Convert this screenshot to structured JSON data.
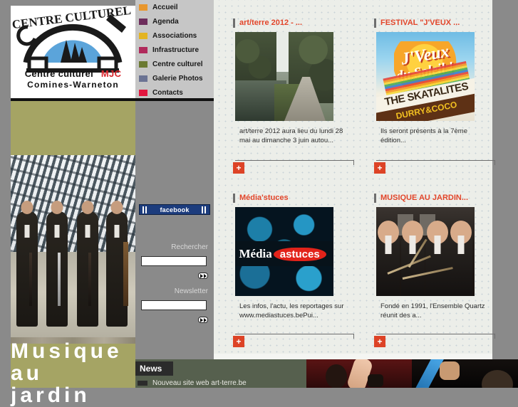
{
  "site": {
    "logo": {
      "arc_text": "CENTRE CULTUREL",
      "line1": "Centre culturel",
      "line1_accent": "MJC",
      "line2": "Comines-Warneton"
    }
  },
  "nav": {
    "items": [
      {
        "label": "Accueil",
        "color": "#e8972e",
        "name": "nav-item-accueil"
      },
      {
        "label": "Agenda",
        "color": "#6d2d5c",
        "name": "nav-item-agenda"
      },
      {
        "label": "Associations",
        "color": "#e3b423",
        "name": "nav-item-associations"
      },
      {
        "label": "Infrastructure",
        "color": "#b02a5b",
        "name": "nav-item-infrastructure"
      },
      {
        "label": "Centre culturel",
        "color": "#6b7a32",
        "name": "nav-item-centre-culturel"
      },
      {
        "label": "Galerie Photos",
        "color": "#6b7393",
        "name": "nav-item-galerie-photos"
      },
      {
        "label": "Contacts",
        "color": "#e2163f",
        "name": "nav-item-contacts"
      }
    ]
  },
  "sidebar": {
    "facebook_label": "facebook",
    "search": {
      "label": "Rechercher",
      "value": "",
      "placeholder": "",
      "go_label": "▶▶"
    },
    "newsletter": {
      "label": "Newsletter",
      "value": "",
      "placeholder": "",
      "go_label": "▶▶"
    }
  },
  "left_feature": {
    "title_line1": "Musique",
    "title_line2": "au",
    "title_line3": "jardin"
  },
  "cards": [
    {
      "title": "art/terre 2012 - ...",
      "desc": "art/terre 2012 aura lieu du lundi 28 mai au dimanche 3 juin autou...",
      "plus_label": "+",
      "thumb": "canal-path-photo"
    },
    {
      "title": "FESTIVAL \"J'VEUX ...",
      "desc": "Ils seront présents à la 7ème édition...",
      "plus_label": "+",
      "thumb": "jveux-du-soleil-poster",
      "poster": {
        "line1": "J'Veux",
        "line2": "du Soleil !",
        "band1": "THE SKATALITES",
        "band2": "DURRY&COCO"
      }
    },
    {
      "title": "Média'stuces",
      "desc": "Les infos, l'actu, les reportages sur www.mediastuces.bePui...",
      "plus_label": "+",
      "thumb": "mediastuces-logo",
      "logo": {
        "part1": "Média",
        "part2": "astuces"
      }
    },
    {
      "title": "MUSIQUE AU JARDIN...",
      "desc": "Fondé en 1991, l'Ensemble Quartz réunit des a...",
      "plus_label": "+",
      "thumb": "ensemble-quartz-photo"
    }
  ],
  "news": {
    "tab_label": "News",
    "items": [
      {
        "label": "Nouveau site web art-terre.be"
      }
    ]
  },
  "colors": {
    "accent_red": "#e2452a",
    "plus_button": "#dd4326",
    "nav_bg": "#c6c6c6",
    "page_bg": "#8a8a8a",
    "olive": "#a5a464",
    "news_bg": "#56604e",
    "content_bg": "#eceee9",
    "facebook_blue": "#1c3c7d"
  }
}
